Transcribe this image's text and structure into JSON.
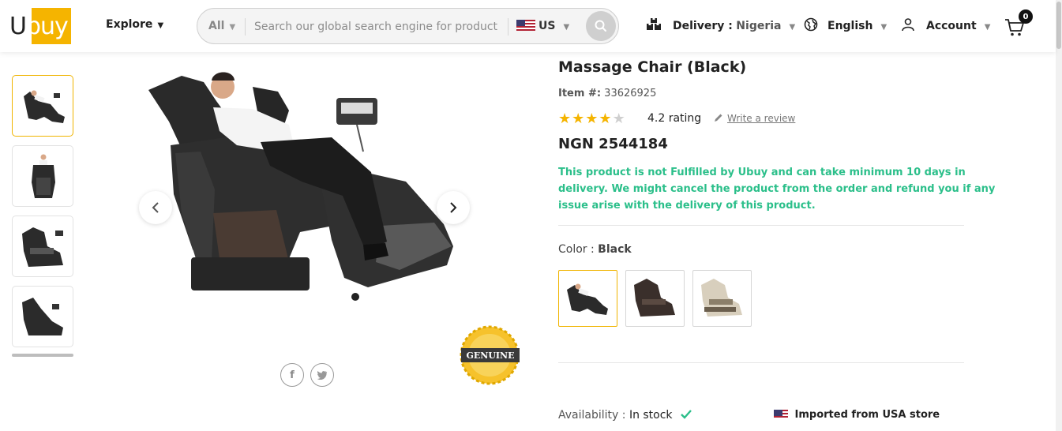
{
  "header": {
    "logo_text_first": "U",
    "logo_text_rest": "buy",
    "explore_label": "Explore",
    "search": {
      "category": "All",
      "placeholder": "Search our global search engine for product",
      "country": "US"
    },
    "delivery_label": "Delivery :",
    "delivery_country": "Nigeria",
    "language": "English",
    "account_label": "Account",
    "cart_count": "0"
  },
  "product": {
    "title": "Massage Chair (Black)",
    "item_label": "Item #:",
    "item_number": "33626925",
    "rating_value": 4.2,
    "rating_text": "4.2 rating",
    "write_review": "Write a review",
    "price": "NGN 2544184",
    "fulfillment_notice": "This product is not Fulfilled by Ubuy and can take minimum 10 days in delivery. We might cancel the product from the order and refund you if any issue arise with the delivery of this product.",
    "color_label": "Color :",
    "color_selected": "Black",
    "color_options": [
      "Black",
      "Brown",
      "Cream"
    ],
    "availability_label": "Availability :",
    "availability_value": "In stock",
    "imported_text": "Imported from USA store"
  },
  "gallery": {
    "genuine_badge": "GENUINE",
    "thumbnail_count": 4
  },
  "colors": {
    "accent": "#f5b400",
    "notice_green": "#2bbf8a"
  }
}
